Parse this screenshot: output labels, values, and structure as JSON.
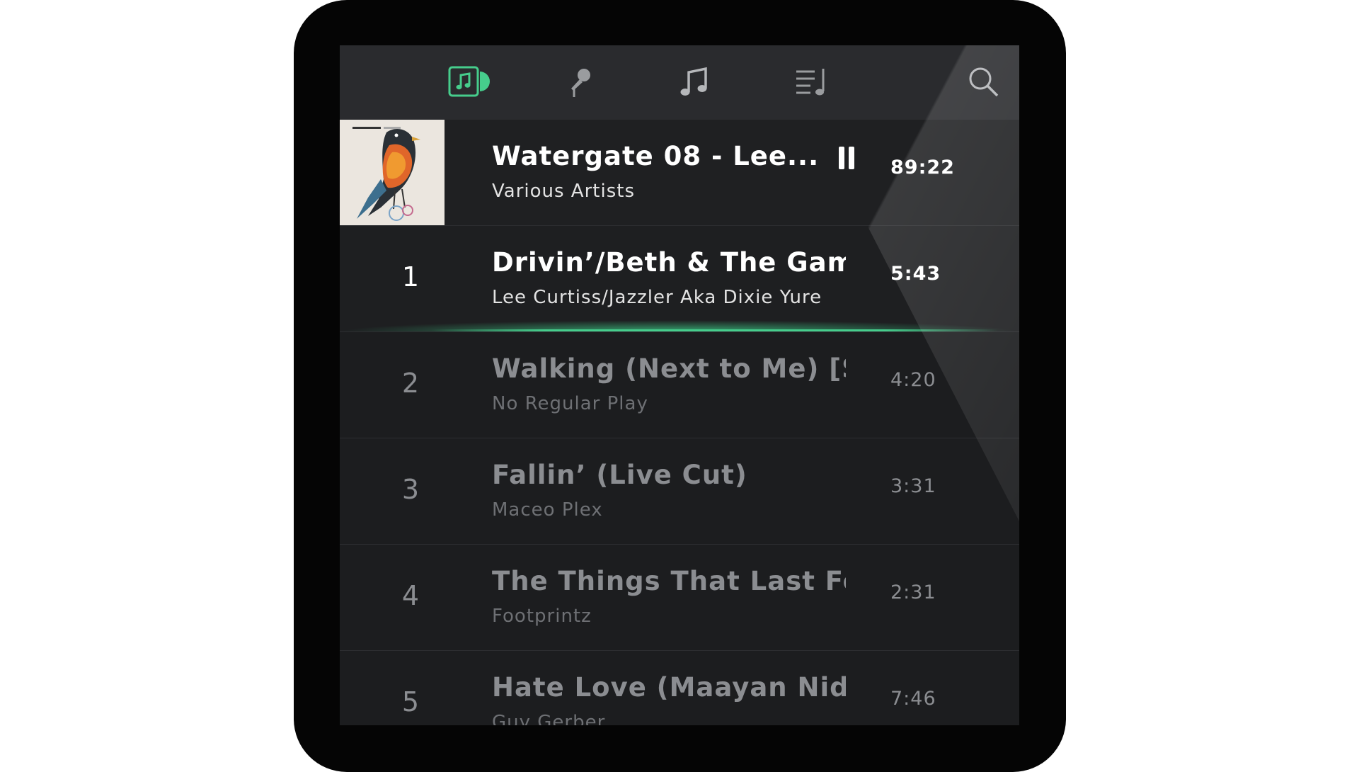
{
  "theme": {
    "accent": "#46cd8c",
    "background": "#1c1d1f",
    "topbar": "#2a2b2e",
    "device_frame": "#050505"
  },
  "tabs": [
    {
      "icon": "now-playing-icon",
      "active": true
    },
    {
      "icon": "microphone-icon",
      "active": false
    },
    {
      "icon": "music-note-icon",
      "active": false
    },
    {
      "icon": "playlist-icon",
      "active": false
    },
    {
      "icon": "search-icon",
      "active": false
    }
  ],
  "now_playing": {
    "title": "Watergate 08 - Lee...",
    "artist": "Various Artists",
    "duration": "89:22",
    "state": "playing",
    "control_icon": "pause-icon"
  },
  "tracks": [
    {
      "number": "1",
      "title": "Drivin’/Beth & The Gamm...",
      "artist": "Lee Curtiss/Jazzler Aka Dixie Yure",
      "duration": "5:43",
      "active": true
    },
    {
      "number": "2",
      "title": "Walking (Next to Me) [Sh...",
      "artist": "No Regular Play",
      "duration": "4:20",
      "active": false
    },
    {
      "number": "3",
      "title": "Fallin’ (Live Cut)",
      "artist": "Maceo Plex",
      "duration": "3:31",
      "active": false
    },
    {
      "number": "4",
      "title": "The Things That Last Fore...",
      "artist": "Footprintz",
      "duration": "2:31",
      "active": false
    },
    {
      "number": "5",
      "title": "Hate Love (Maayan Nida...",
      "artist": "Guy Gerber",
      "duration": "7:46",
      "active": false
    }
  ]
}
